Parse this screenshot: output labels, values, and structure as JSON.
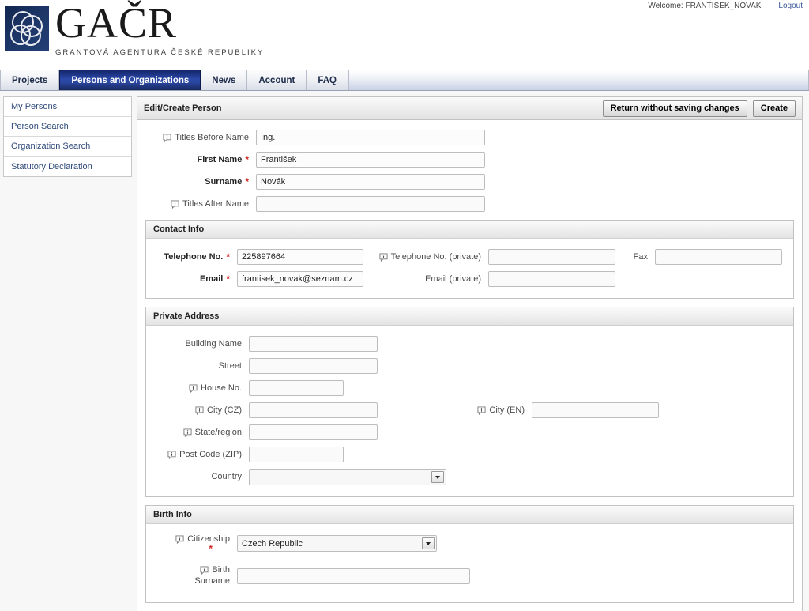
{
  "header": {
    "welcome_text": "Welcome: FRANTISEK_NOVAK",
    "logout_label": "Logout",
    "logo_title": "GAČR",
    "logo_subtitle": "GRANTOVÁ AGENTURA ČESKÉ REPUBLIKY"
  },
  "nav": {
    "tabs": [
      {
        "label": "Projects",
        "active": false
      },
      {
        "label": "Persons and Organizations",
        "active": true
      },
      {
        "label": "News",
        "active": false
      },
      {
        "label": "Account",
        "active": false
      },
      {
        "label": "FAQ",
        "active": false
      }
    ]
  },
  "sidebar": {
    "items": [
      {
        "label": "My Persons"
      },
      {
        "label": "Person Search"
      },
      {
        "label": "Organization Search"
      },
      {
        "label": "Statutory Declaration"
      }
    ]
  },
  "panel": {
    "title": "Edit/Create Person",
    "return_button": "Return without saving changes",
    "create_button": "Create"
  },
  "name_fields": {
    "titles_before_label": "Titles Before Name",
    "titles_before_value": "Ing.",
    "first_name_label": "First Name",
    "first_name_value": "František",
    "surname_label": "Surname",
    "surname_value": "Novák",
    "titles_after_label": "Titles After Name",
    "titles_after_value": "",
    "required_marker": "*"
  },
  "contact_info": {
    "section_title": "Contact Info",
    "telephone_label": "Telephone No.",
    "telephone_value": "225897664",
    "telephone_private_label": "Telephone No. (private)",
    "telephone_private_value": "",
    "fax_label": "Fax",
    "fax_value": "",
    "email_label": "Email",
    "email_value": "frantisek_novak@seznam.cz",
    "email_private_label": "Email (private)",
    "email_private_value": ""
  },
  "private_address": {
    "section_title": "Private Address",
    "building_label": "Building Name",
    "building_value": "",
    "street_label": "Street",
    "street_value": "",
    "house_no_label": "House No.",
    "house_no_value": "",
    "city_cz_label": "City (CZ)",
    "city_cz_value": "",
    "city_en_label": "City (EN)",
    "city_en_value": "",
    "state_region_label": "State/region",
    "state_region_value": "",
    "post_code_label": "Post Code (ZIP)",
    "post_code_value": "",
    "country_label": "Country",
    "country_value": ""
  },
  "birth_info": {
    "section_title": "Birth Info",
    "citizenship_label": "Citizenship",
    "citizenship_value": "Czech Republic",
    "citizenship_required": "*",
    "birth_surname_label_line1": "Birth",
    "birth_surname_label_line2": "Surname",
    "birth_surname_value": ""
  },
  "icons": {
    "info": "info-bubble-icon",
    "dropdown": "chevron-down-icon"
  },
  "colors": {
    "active_tab": "#2b49a8",
    "link": "#3c5a99",
    "required": "#d42a2a",
    "logo_navy": "#1c3566"
  }
}
